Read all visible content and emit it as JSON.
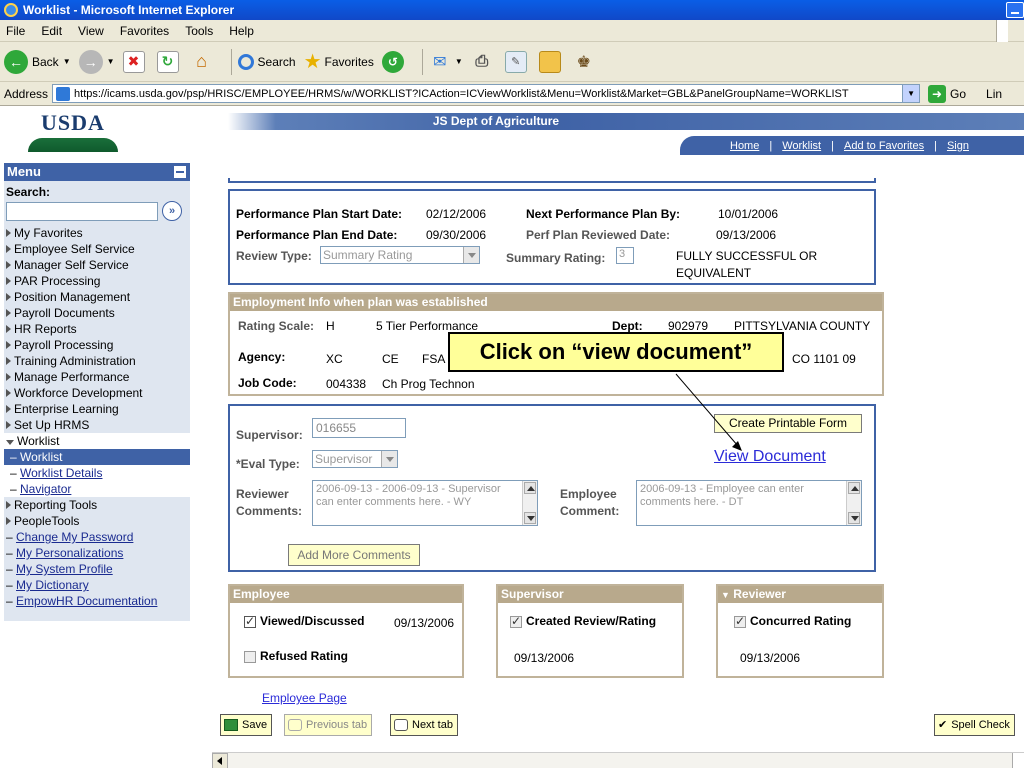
{
  "window": {
    "title": "Worklist - Microsoft Internet Explorer"
  },
  "menubar": [
    "File",
    "Edit",
    "View",
    "Favorites",
    "Tools",
    "Help"
  ],
  "toolbar": {
    "back_label": "Back",
    "search_label": "Search",
    "favorites_label": "Favorites"
  },
  "address": {
    "label": "Address",
    "url": "https://icams.usda.gov/psp/HRISC/EMPLOYEE/HRMS/w/WORKLIST?ICAction=ICViewWorklist&Menu=Worklist&Market=GBL&PanelGroupName=WORKLIST",
    "go_label": "Go",
    "links_label": "Lin"
  },
  "header": {
    "logo_text": "USDA",
    "org_title": "JS Dept of Agriculture",
    "nav": [
      "Home",
      "Worklist",
      "Add to Favorites",
      "Sign"
    ]
  },
  "sidebar": {
    "title": "Menu",
    "search_label": "Search:",
    "search_go": "»",
    "items": [
      {
        "label": "My Favorites",
        "kind": "folder"
      },
      {
        "label": "Employee Self Service",
        "kind": "folder"
      },
      {
        "label": "Manager Self Service",
        "kind": "folder"
      },
      {
        "label": "PAR Processing",
        "kind": "folder"
      },
      {
        "label": "Position Management",
        "kind": "folder"
      },
      {
        "label": "Payroll Documents",
        "kind": "folder"
      },
      {
        "label": "HR Reports",
        "kind": "folder"
      },
      {
        "label": "Payroll Processing",
        "kind": "folder"
      },
      {
        "label": "Training Administration",
        "kind": "folder"
      },
      {
        "label": "Manage Performance",
        "kind": "folder"
      },
      {
        "label": "Workforce Development",
        "kind": "folder"
      },
      {
        "label": "Enterprise Learning",
        "kind": "folder"
      },
      {
        "label": "Set Up HRMS",
        "kind": "folder"
      },
      {
        "label": "Worklist",
        "kind": "open"
      },
      {
        "label": "Worklist",
        "kind": "selected"
      },
      {
        "label": "Worklist Details",
        "kind": "sub"
      },
      {
        "label": "Navigator",
        "kind": "sub"
      },
      {
        "label": "Reporting Tools",
        "kind": "folder"
      },
      {
        "label": "PeopleTools",
        "kind": "folder"
      },
      {
        "label": "Change My Password",
        "kind": "link"
      },
      {
        "label": "My Personalizations",
        "kind": "link"
      },
      {
        "label": "My System Profile",
        "kind": "link"
      },
      {
        "label": "My Dictionary",
        "kind": "link"
      },
      {
        "label": "EmpowHR Documentation",
        "kind": "link"
      }
    ]
  },
  "plan": {
    "start_label": "Performance Plan Start Date:",
    "start_value": "02/12/2006",
    "next_label": "Next Performance Plan By:",
    "next_value": "10/01/2006",
    "end_label": "Performance Plan End Date:",
    "end_value": "09/30/2006",
    "reviewed_label": "Perf Plan Reviewed Date:",
    "reviewed_value": "09/13/2006",
    "review_type_label": "Review Type:",
    "review_type_value": "Summary Rating",
    "summary_label": "Summary Rating:",
    "summary_value": "3",
    "summary_desc_1": "FULLY SUCCESSFUL OR",
    "summary_desc_2": "EQUIVALENT"
  },
  "employment": {
    "title": "Employment Info when plan was established",
    "rating_scale_label": "Rating Scale:",
    "rating_scale_code": "H",
    "rating_scale_desc": "5 Tier Performance",
    "dept_label": "Dept:",
    "dept_code": "902979",
    "dept_desc": "PITTSYLVANIA COUNTY",
    "agency_label": "Agency:",
    "agency_code": "XC",
    "agency_sub": "CE",
    "agency_part": "FSA",
    "agency_tail": "CO 1101 09",
    "job_code_label": "Job Code:",
    "job_code_value": "004338",
    "job_code_desc": "Ch Prog Technon"
  },
  "callout": {
    "text": "Click on “view document”"
  },
  "review": {
    "supervisor_label": "Supervisor:",
    "supervisor_value": "016655",
    "eval_type_label": "*Eval Type:",
    "eval_type_value": "Supervisor",
    "print_button": "Create Printable Form",
    "view_document": "View Document",
    "reviewer_label_1": "Reviewer",
    "reviewer_label_2": "Comments:",
    "reviewer_text": "2006-09-13 - 2006-09-13 - Supervisor can enter comments here. - WY",
    "employee_label_1": "Employee",
    "employee_label_2": "Comment:",
    "employee_text": "2006-09-13 - Employee can enter comments here. - DT",
    "add_comments": "Add More Comments"
  },
  "panels": {
    "employee": {
      "title": "Employee",
      "viewed_label": "Viewed/Discussed",
      "viewed_date": "09/13/2006",
      "refused_label": "Refused Rating"
    },
    "supervisor": {
      "title": "Supervisor",
      "created_label": "Created Review/Rating",
      "created_date": "09/13/2006"
    },
    "reviewer": {
      "title": "Reviewer",
      "concurred_label": "Concurred Rating",
      "concurred_date": "09/13/2006"
    }
  },
  "footer": {
    "employee_page": "Employee Page",
    "save": "Save",
    "previous_tab": "Previous tab",
    "next_tab": "Next tab",
    "spell_check": "Spell Check"
  },
  "colors": {
    "nav_blue": "#3f62a6",
    "section_tan": "#b8a98c",
    "callout_yellow": "#ffff99"
  }
}
